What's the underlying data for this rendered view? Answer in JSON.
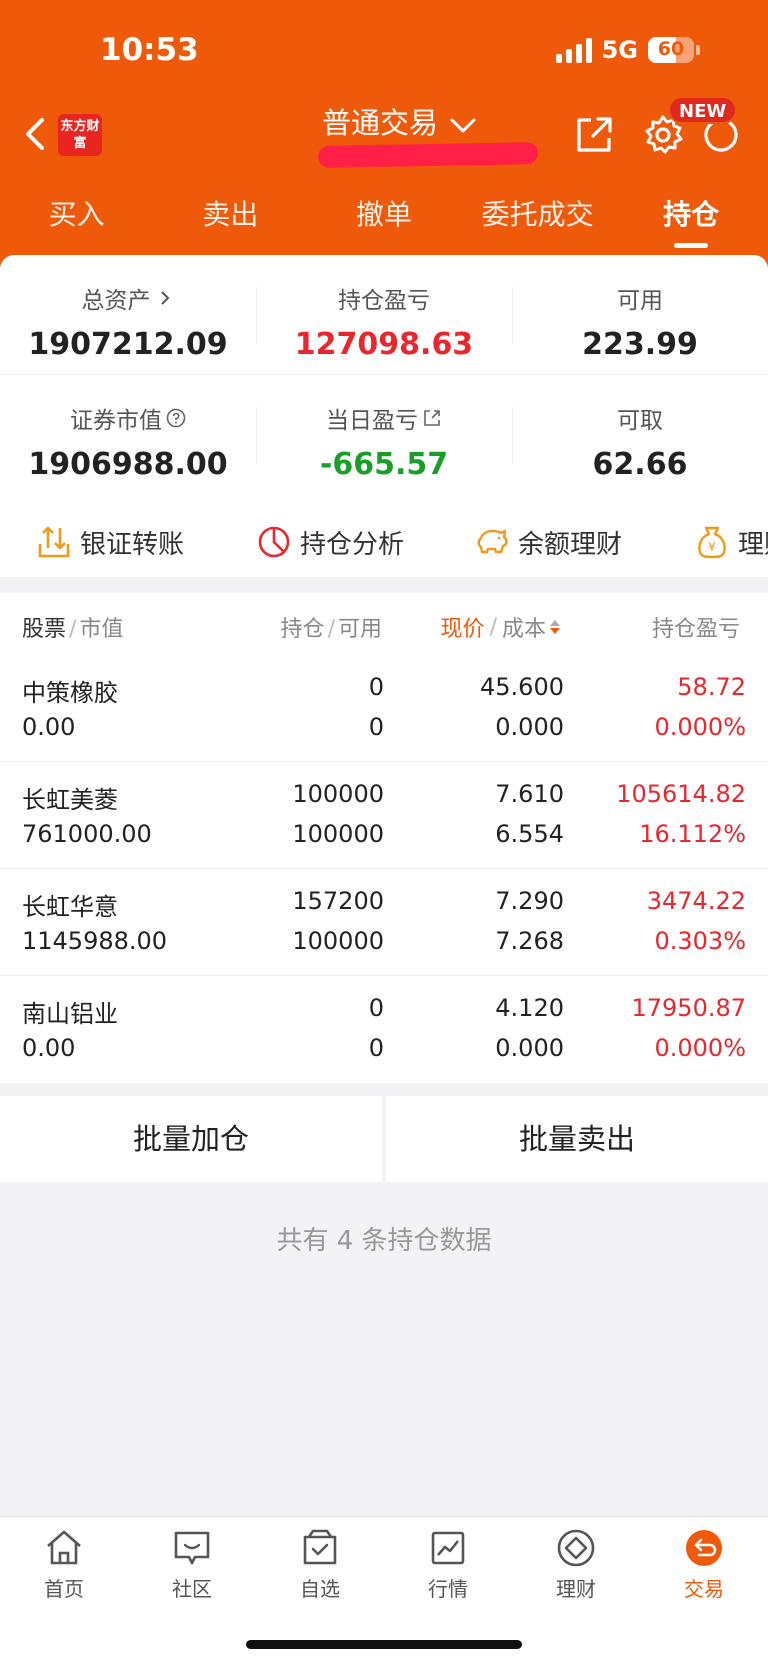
{
  "status_bar": {
    "time": "10:53",
    "network": "5G",
    "battery": "60",
    "battery_level": 0.6
  },
  "header": {
    "logo_text": "东方财富",
    "title": "普通交易",
    "new_badge": "NEW",
    "tabs": [
      {
        "label": "买入",
        "active": false
      },
      {
        "label": "卖出",
        "active": false
      },
      {
        "label": "撤单",
        "active": false
      },
      {
        "label": "委托成交",
        "active": false
      },
      {
        "label": "持仓",
        "active": true
      }
    ]
  },
  "summary": {
    "total_assets": {
      "label": "总资产",
      "value": "1907212.09"
    },
    "position_pl": {
      "label": "持仓盈亏",
      "value": "127098.63"
    },
    "available": {
      "label": "可用",
      "value": "223.99"
    },
    "market_value": {
      "label": "证券市值",
      "value": "1906988.00"
    },
    "daily_pl": {
      "label": "当日盈亏",
      "value": "-665.57"
    },
    "withdrawable": {
      "label": "可取",
      "value": "62.66"
    }
  },
  "functions": [
    {
      "label": "银证转账",
      "icon": "transfer-icon"
    },
    {
      "label": "持仓分析",
      "icon": "pie-chart-icon"
    },
    {
      "label": "余额理财",
      "icon": "piggy-bank-icon"
    },
    {
      "label": "理财",
      "icon": "money-bag-icon"
    }
  ],
  "table": {
    "headers": {
      "stock": "股票",
      "market_value": "市值",
      "position": "持仓",
      "available": "可用",
      "price": "现价",
      "cost": "成本",
      "pl": "持仓盈亏"
    },
    "rows": [
      {
        "name": "中策橡胶",
        "market_value": "0.00",
        "position": "0",
        "available": "0",
        "price": "45.600",
        "cost": "0.000",
        "pl": "58.72",
        "pl_pct": "0.000%"
      },
      {
        "name": "长虹美菱",
        "market_value": "761000.00",
        "position": "100000",
        "available": "100000",
        "price": "7.610",
        "cost": "6.554",
        "pl": "105614.82",
        "pl_pct": "16.112%"
      },
      {
        "name": "长虹华意",
        "market_value": "1145988.00",
        "position": "157200",
        "available": "100000",
        "price": "7.290",
        "cost": "7.268",
        "pl": "3474.22",
        "pl_pct": "0.303%"
      },
      {
        "name": "南山铝业",
        "market_value": "0.00",
        "position": "0",
        "available": "0",
        "price": "4.120",
        "cost": "0.000",
        "pl": "17950.87",
        "pl_pct": "0.000%"
      }
    ]
  },
  "batch": {
    "add_label": "批量加仓",
    "sell_label": "批量卖出"
  },
  "footer_note": "共有 4 条持仓数据",
  "bottom_nav": [
    {
      "label": "首页",
      "icon": "home-icon"
    },
    {
      "label": "社区",
      "icon": "chat-icon"
    },
    {
      "label": "自选",
      "icon": "watchlist-icon"
    },
    {
      "label": "行情",
      "icon": "market-chart-icon"
    },
    {
      "label": "理财",
      "icon": "diamond-icon"
    },
    {
      "label": "交易",
      "icon": "trade-icon",
      "active": true
    }
  ],
  "colors": {
    "brand": "#ee5a09",
    "up": "#e8262c",
    "down": "#1a9e2a"
  }
}
